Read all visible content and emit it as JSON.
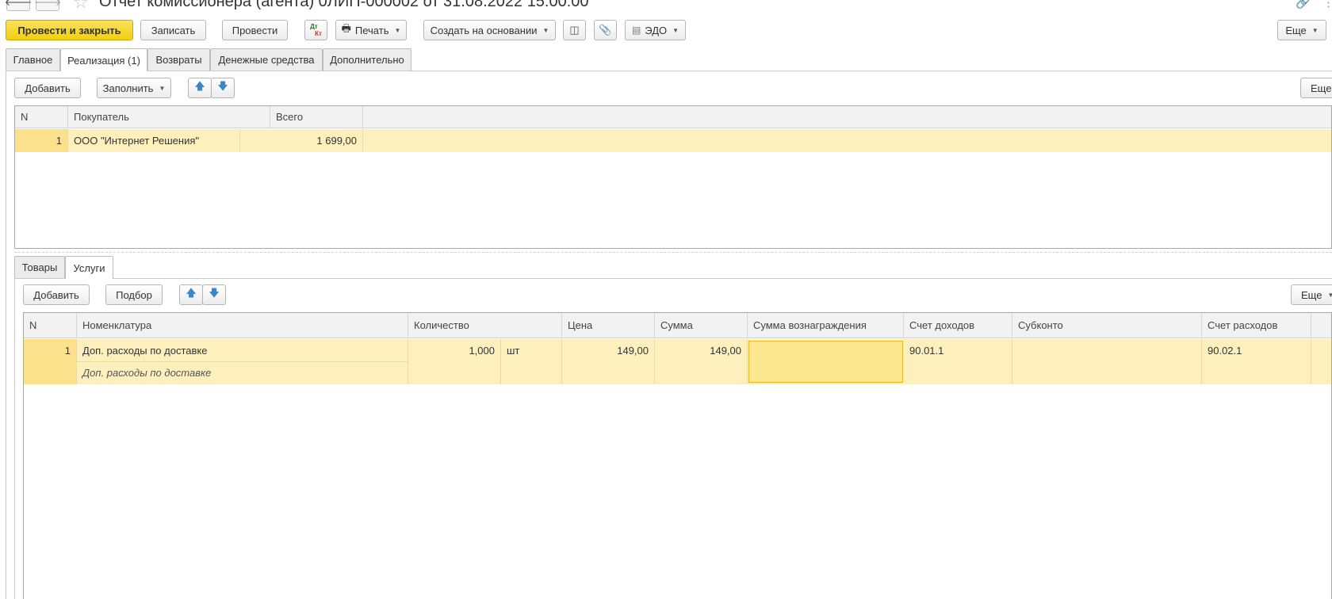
{
  "window": {
    "title": "Отчет комиссионера (агента) 0ЛИП-000002 от 31.08.2022 15:00:00"
  },
  "toolbar": {
    "post_close": "Провести и закрыть",
    "save": "Записать",
    "post": "Провести",
    "dtkt_top": "Дт",
    "dtkt_bottom": "Кт",
    "print": "Печать",
    "create_based": "Создать на основании",
    "edo": "ЭДО",
    "more": "Еще"
  },
  "tabs": [
    "Главное",
    "Реализация (1)",
    "Возвраты",
    "Денежные средства",
    "Дополнительно"
  ],
  "sales": {
    "add": "Добавить",
    "fill": "Заполнить",
    "more": "Еще",
    "headers": {
      "n": "N",
      "buyer": "Покупатель",
      "total": "Всего"
    },
    "rows": [
      {
        "n": "1",
        "buyer": "ООО \"Интернет Решения\"",
        "total": "1 699,00"
      }
    ]
  },
  "subtabs": [
    "Товары",
    "Услуги"
  ],
  "services": {
    "add": "Добавить",
    "pick": "Подбор",
    "more": "Еще",
    "headers": {
      "n": "N",
      "nomenclature": "Номенклатура",
      "qty": "Количество",
      "price": "Цена",
      "sum": "Сумма",
      "reward": "Сумма вознаграждения",
      "income": "Счет доходов",
      "subconto": "Субконто",
      "expense": "Счет расходов"
    },
    "rows": [
      {
        "n": "1",
        "nomenclature": "Доп. расходы по доставке",
        "nomenclature_sub": "Доп. расходы по доставке",
        "qty": "1,000",
        "unit": "шт",
        "price": "149,00",
        "sum": "149,00",
        "reward": "",
        "income": "90.01.1",
        "subconto": "",
        "expense": "90.02.1"
      }
    ]
  }
}
